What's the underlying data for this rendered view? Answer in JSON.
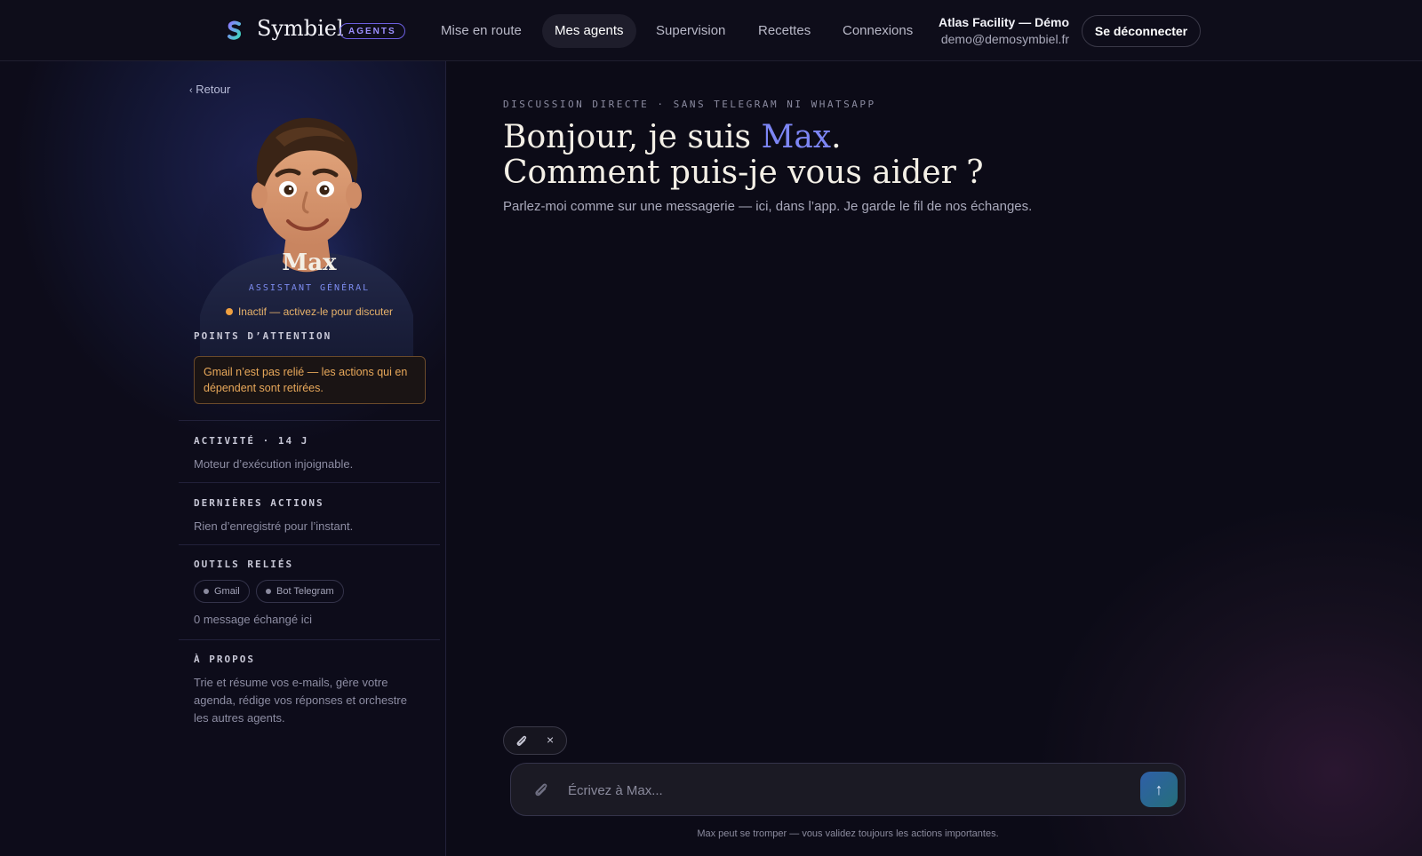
{
  "header": {
    "brand": "Symbiel",
    "badge": "AGENTS",
    "nav": [
      "Mise en route",
      "Mes agents",
      "Supervision",
      "Recettes",
      "Connexions"
    ],
    "active_nav": "Mes agents",
    "user_name": "Atlas Facility — Démo",
    "user_email": "demo@demosymbiel.fr",
    "logout_label": "Se déconnecter"
  },
  "sidebar": {
    "back_label": "Retour",
    "agent_name": "Max",
    "agent_role": "ASSISTANT GÉNÉRAL",
    "status_text": "Inactif — activez-le pour discuter",
    "attention_title": "POINTS D’ATTENTION",
    "attention_text": "Gmail n’est pas relié — les actions qui en dépendent sont retirées.",
    "activity_title": "ACTIVITÉ · 14 J",
    "activity_text": "Moteur d’exécution injoignable.",
    "actions_title": "DERNIÈRES ACTIONS",
    "actions_text": "Rien d’enregistré pour l’instant.",
    "tools_title": "OUTILS RELIÉS",
    "tools": [
      "Gmail",
      "Bot Telegram"
    ],
    "messages_count": "0 message échangé ici",
    "about_title": "À PROPOS",
    "about_text": "Trie et résume vos e-mails, gère votre agenda, rédige vos réponses et orchestre les autres agents."
  },
  "main": {
    "eyebrow": "DISCUSSION DIRECTE · SANS TELEGRAM NI WHATSAPP",
    "hero_line1_prefix": "Bonjour, je suis ",
    "hero_name": "Max",
    "hero_line1_suffix": ".",
    "hero_line2": "Comment puis-je vous aider ?",
    "subtitle": "Parlez-moi comme sur une messagerie — ici, dans l’app. Je garde le fil de nos échanges.",
    "attach_close": "×",
    "input_placeholder": "Écrivez à Max...",
    "send_icon": "↑",
    "disclaimer": "Max peut se tromper — vous validez toujours les actions importantes."
  },
  "colors": {
    "accent": "#7d86f5",
    "badge": "#9d90ff",
    "warning": "#e8a85a",
    "status_dot": "#f0a040"
  },
  "icons": [
    "symbiel-logo-icon",
    "paperclip-icon",
    "close-icon",
    "send-arrow-icon",
    "status-dot-icon",
    "chevron-left-icon"
  ]
}
